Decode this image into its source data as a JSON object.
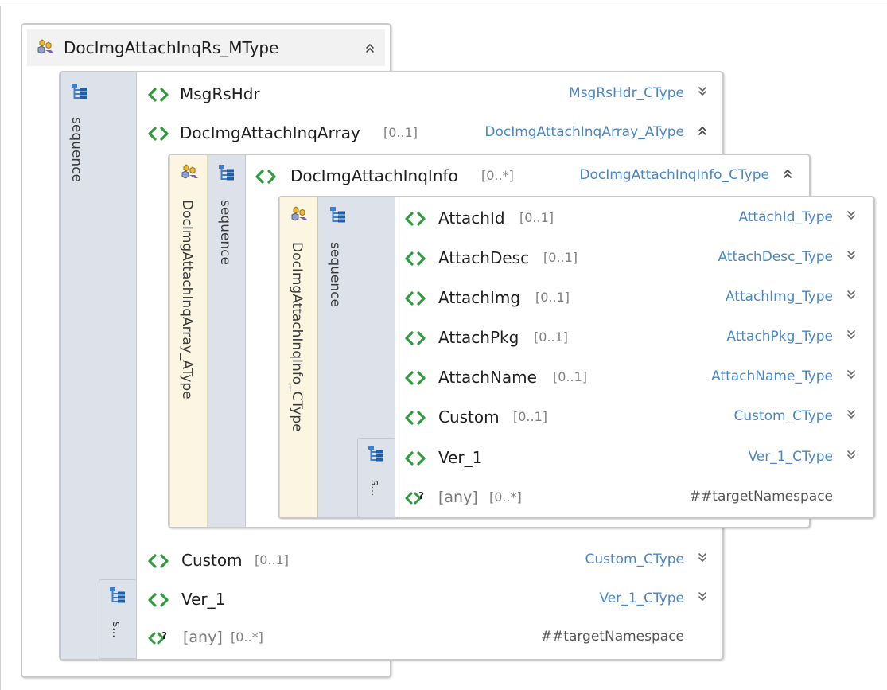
{
  "root": {
    "title": "DocImgAttachInqRs_MType",
    "sequence_label": "sequence",
    "sequence_small_label": "s...",
    "elements": [
      {
        "name": "MsgRsHdr",
        "card": "",
        "type": "MsgRsHdr_CType",
        "state": "collapsed"
      },
      {
        "name": "DocImgAttachInqArray",
        "card": "[0..1]",
        "type": "DocImgAttachInqArray_AType",
        "state": "expanded"
      },
      {
        "name": "Custom",
        "card": "[0..1]",
        "type": "Custom_CType",
        "state": "collapsed"
      },
      {
        "name": "Ver_1",
        "card": "",
        "type": "Ver_1_CType",
        "state": "collapsed"
      }
    ],
    "any": {
      "text": "[any]",
      "card": "[0..*]",
      "namespace": "##targetNamespace"
    }
  },
  "array_type": {
    "type_label": "DocImgAttachInqArray_AType",
    "sequence_label": "sequence",
    "element": {
      "name": "DocImgAttachInqInfo",
      "card": "[0..*]",
      "type": "DocImgAttachInqInfo_CType",
      "state": "expanded"
    }
  },
  "info_type": {
    "type_label": "DocImgAttachInqInfo_CType",
    "sequence_label": "sequence",
    "sequence_small_label": "s...",
    "elements": [
      {
        "name": "AttachId",
        "card": "[0..1]",
        "type": "AttachId_Type",
        "state": "collapsed"
      },
      {
        "name": "AttachDesc",
        "card": "[0..1]",
        "type": "AttachDesc_Type",
        "state": "collapsed"
      },
      {
        "name": "AttachImg",
        "card": "[0..1]",
        "type": "AttachImg_Type",
        "state": "collapsed"
      },
      {
        "name": "AttachPkg",
        "card": "[0..1]",
        "type": "AttachPkg_Type",
        "state": "collapsed"
      },
      {
        "name": "AttachName",
        "card": "[0..1]",
        "type": "AttachName_Type",
        "state": "collapsed"
      },
      {
        "name": "Custom",
        "card": "[0..1]",
        "type": "Custom_CType",
        "state": "collapsed"
      },
      {
        "name": "Ver_1",
        "card": "",
        "type": "Ver_1_CType",
        "state": "collapsed"
      }
    ],
    "any": {
      "text": "[any]",
      "card": "[0..*]",
      "namespace": "##targetNamespace"
    }
  },
  "icons": {
    "element": "element-icon",
    "any": "any-element-icon",
    "sequence": "sequence-icon",
    "complex_type": "complex-type-icon",
    "expand": "double-chevron-down-icon",
    "collapse": "double-chevron-up-icon"
  },
  "colors": {
    "element_green": "#2f9a3e",
    "type_link_blue": "#4a86c8",
    "sequence_bar": "#dde1ea",
    "type_bar": "#fbf5e2"
  }
}
